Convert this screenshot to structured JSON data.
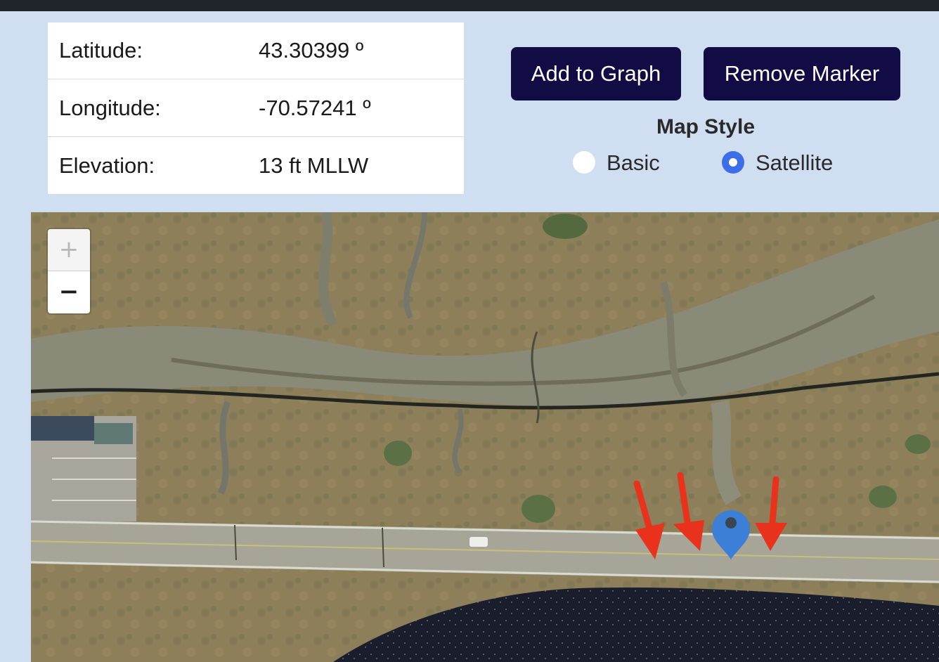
{
  "info": {
    "rows": [
      {
        "label": "Latitude:",
        "value": "43.30399 º"
      },
      {
        "label": "Longitude:",
        "value": "-70.57241 º"
      },
      {
        "label": "Elevation:",
        "value": "13 ft MLLW"
      }
    ]
  },
  "actions": {
    "add_label": "Add to Graph",
    "remove_label": "Remove Marker"
  },
  "map_style": {
    "title": "Map Style",
    "options": [
      {
        "label": "Basic",
        "checked": false
      },
      {
        "label": "Satellite",
        "checked": true
      }
    ]
  },
  "map": {
    "zoom_in": "+",
    "zoom_out": "−",
    "marker_color": "#3b7fd6",
    "annotation_color": "#e8321c"
  }
}
